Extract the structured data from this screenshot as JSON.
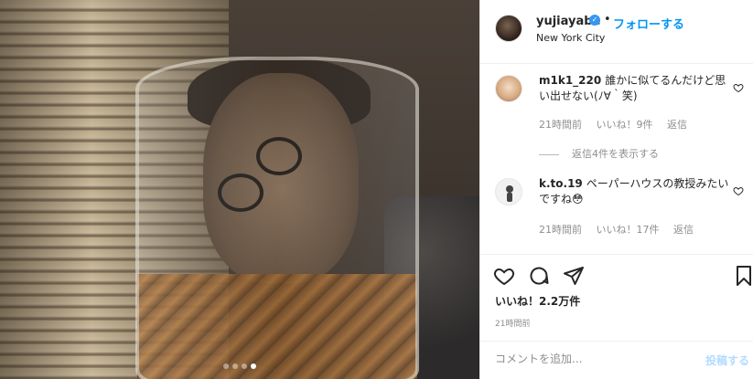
{
  "post": {
    "username": "yujiayabe",
    "verified_mark": "✓",
    "separator": "•",
    "follow_label": "フォローする",
    "location": "New York City",
    "carousel": {
      "count": 4,
      "active_index": 3
    }
  },
  "comments": [
    {
      "user": "m1k1_220",
      "text": "誰かに似てるんだけど思い出せない(ﾉ∀｀笑)",
      "time": "21時間前",
      "likes": "いいね！9件",
      "reply": "返信",
      "view_replies": "返信4件を表示する"
    },
    {
      "user": "k.to.19",
      "text": "ペーパーハウスの教授みたいですね😳",
      "time": "21時間前",
      "likes": "いいね！17件",
      "reply": "返信"
    }
  ],
  "actions": {
    "icons": [
      "heart-icon",
      "comment-icon",
      "share-icon",
      "bookmark-icon"
    ],
    "likes_text": "いいね！2.2万件",
    "time": "21時間前"
  },
  "add_comment": {
    "placeholder": "コメントを追加...",
    "post_label": "投稿する"
  },
  "colors": {
    "accent": "#0095f6",
    "verified": "#3897f0",
    "muted": "#8e8e8e",
    "post_disabled": "#b3dbff"
  }
}
